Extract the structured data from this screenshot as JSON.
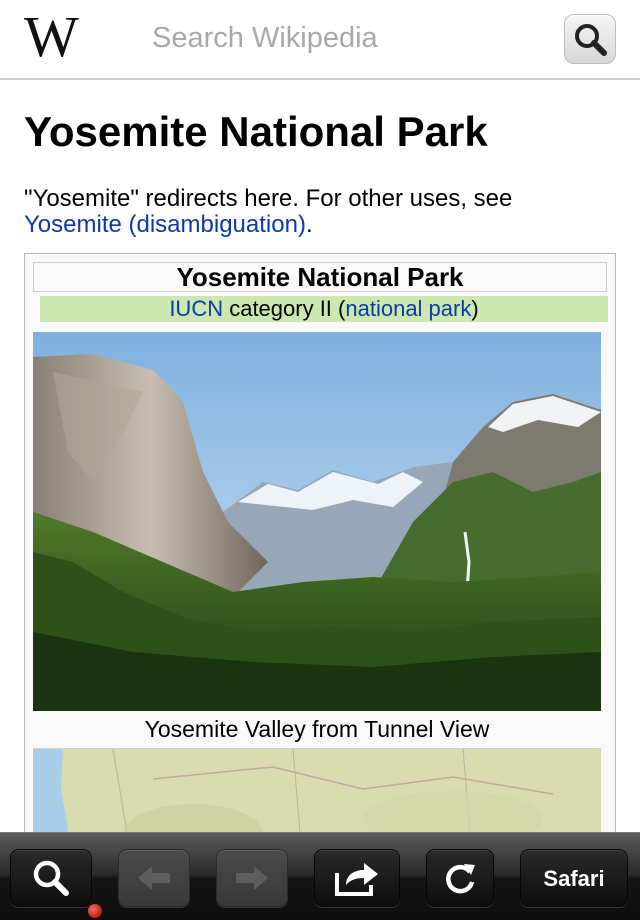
{
  "header": {
    "logo_text": "W",
    "search_placeholder": "Search Wikipedia"
  },
  "article": {
    "title": "Yosemite National Park",
    "hatnote_prefix": "\"Yosemite\" redirects here. For other uses, see ",
    "hatnote_link": "Yosemite (disambiguation)",
    "hatnote_suffix": "."
  },
  "infobox": {
    "title": "Yosemite National Park",
    "category_link1": "IUCN",
    "category_text": " category II (",
    "category_link2": "national park",
    "category_close": ")",
    "image_caption": "Yosemite Valley from Tunnel View"
  },
  "toolbar": {
    "safari_label": "Safari"
  },
  "colors": {
    "link": "#0b3ba8",
    "category_bg": "#cce8b0"
  }
}
